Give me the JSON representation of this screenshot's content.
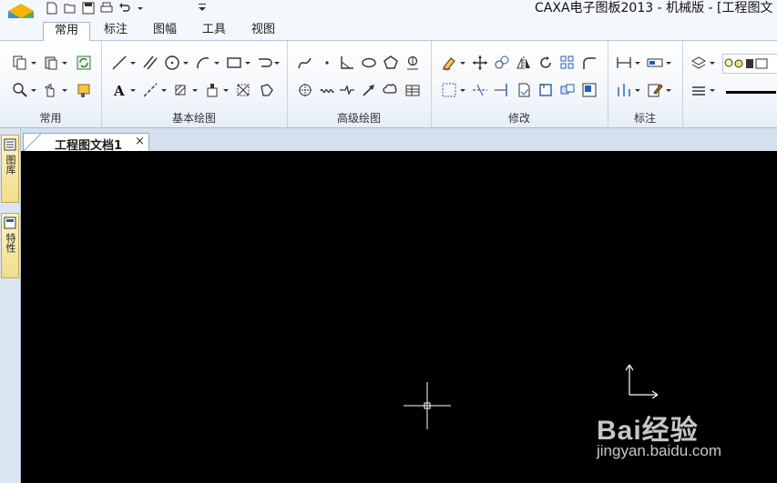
{
  "window": {
    "title": "CAXA电子图板2013 - 机械版 - [工程图文"
  },
  "quick_access": {
    "icons": [
      "new-file-icon",
      "open-file-icon",
      "save-icon",
      "print-icon",
      "undo-icon",
      "customize-icon"
    ]
  },
  "ribbon": {
    "tabs": [
      {
        "label": "常用",
        "active": true
      },
      {
        "label": "标注",
        "active": false
      },
      {
        "label": "图幅",
        "active": false
      },
      {
        "label": "工具",
        "active": false
      },
      {
        "label": "视图",
        "active": false
      }
    ],
    "groups": [
      {
        "label": "常用"
      },
      {
        "label": "基本绘图"
      },
      {
        "label": "高级绘图"
      },
      {
        "label": "修改"
      },
      {
        "label": "标注"
      }
    ]
  },
  "document": {
    "tab_label": "工程图文档1",
    "close_glyph": "×"
  },
  "side_panel": {
    "items": [
      {
        "label": "图库"
      },
      {
        "label": "特性"
      }
    ]
  },
  "watermark": {
    "brand": "Bai经验",
    "url": "jingyan.baidu.com"
  },
  "colors": {
    "canvas": "#000000",
    "ribbon_bg": "#f1f5fa",
    "tab_border": "#9fb7d4",
    "sidetab": "#f2dc8c"
  }
}
